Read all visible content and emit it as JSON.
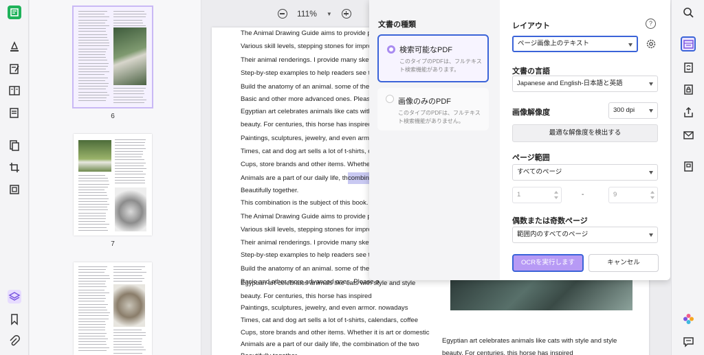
{
  "zoom": {
    "value": "111%"
  },
  "thumbnails": [
    {
      "page": "6"
    },
    {
      "page": "7"
    }
  ],
  "document": {
    "lines": [
      "The Animal Drawing Guide aims to provide peo",
      "Various skill levels, stepping stones for improv",
      "Their animal renderings. I provide many sketch",
      "Step-by-step examples to help readers see the",
      "Build the anatomy of an animal. some of them",
      "Basic and other more advanced ones. Please c",
      "Egyptian art celebrates animals like cats with",
      "beauty. For centuries, this horse has inspired",
      "Paintings, sculptures, jewelry, and even armor",
      "Times, cat and dog art sells a lot of t-shirts, c",
      "Cups, store brands and other items. Whether it",
      "Animals are a part of our daily life, the",
      "Beautifully together.",
      "This combination is the subject of this book. a",
      "The Animal Drawing Guide aims to provide peo",
      "Various skill levels, stepping stones for improv",
      "Their animal renderings. I provide many sketch",
      "Step-by-step examples to help readers see the",
      "Build the anatomy of an animal. some of them",
      "Basic and other more advanced ones. Please o"
    ],
    "highlight": "combin",
    "lower_lines": [
      "Egyptian art celebrates animals like cats with style and style",
      "beauty. For centuries, this horse has inspired",
      "Paintings, sculptures, jewelry, and even armor. nowadays",
      "Times, cat and dog art sells a lot of t-shirts, calendars, coffee",
      "Cups, store brands and other items. Whether it is art or domestic",
      "Animals are a part of our daily life, the combination of the two",
      "Beautifully together."
    ],
    "right_lines": [
      "Egyptian art celebrates animals like cats with style and style",
      "beauty. For centuries, this horse has inspired"
    ]
  },
  "ocr": {
    "doc_type_title": "文書の種類",
    "types": [
      {
        "name": "検索可能なPDF",
        "desc": "このタイプのPDFは、フルテキスト検索機能があります。"
      },
      {
        "name": "画像のみのPDF",
        "desc": "このタイプのPDFは、フルテキスト検索機能がありません。"
      }
    ],
    "layout_label": "レイアウト",
    "layout_value": "ページ画像上のテキスト",
    "language_label": "文書の言語",
    "language_value": "Japanese and English-日本語と英語",
    "resolution_label": "画像解像度",
    "resolution_value": "300 dpi",
    "detect_button": "最適な解像度を検出する",
    "range_label": "ページ範囲",
    "range_value": "すべてのページ",
    "range_from": "1",
    "range_sep": "-",
    "range_to": "9",
    "oddeven_label": "偶数または奇数ページ",
    "oddeven_value": "範囲内のすべてのページ",
    "run_button": "OCRを実行します",
    "cancel_button": "キャンセル",
    "help_glyph": "?"
  },
  "colors": {
    "accent": "#3a63d8",
    "purple": "#b79af5"
  }
}
